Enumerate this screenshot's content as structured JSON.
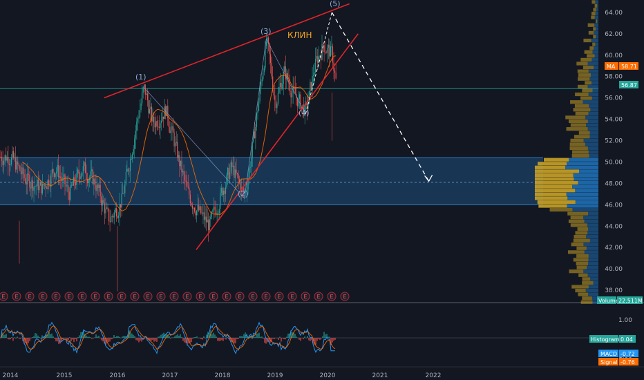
{
  "chart_data": {
    "type": "candlestick",
    "annotation": "КЛИН",
    "wave_labels": [
      "(1)",
      "(2)",
      "(3)",
      "(4)",
      "(5)"
    ],
    "wave_points": [
      {
        "label": "(1)",
        "date": "2016-07",
        "price": 57.0
      },
      {
        "label": "(2)",
        "date": "2018-06",
        "price": 46.6
      },
      {
        "label": "(3)",
        "date": "2018-11",
        "price": 61.5
      },
      {
        "label": "(4)",
        "date": "2019-08",
        "price": 54.5
      },
      {
        "label": "(5)",
        "date": "2020-02",
        "price": 64.0
      }
    ],
    "price_axis_ticks": [
      "64.00",
      "62.00",
      "60.00",
      "58.00",
      "56.00",
      "54.00",
      "52.00",
      "50.00",
      "48.00",
      "46.00",
      "44.00",
      "42.00",
      "40.00",
      "38.00"
    ],
    "time_axis_ticks": [
      "2014",
      "2015",
      "2016",
      "2017",
      "2018",
      "2019",
      "2020",
      "2021",
      "2022"
    ],
    "price_range": [
      36.7,
      65.5
    ],
    "value_area": {
      "high": 50.4,
      "low": 46.0,
      "poc": 48.1
    },
    "horizontal_line": 56.87,
    "upper_wedge_line": [
      {
        "date": "2015-10",
        "price": 56.0
      },
      {
        "date": "2020-06",
        "price": 64.8
      }
    ],
    "lower_wedge_line": [
      {
        "date": "2017-07",
        "price": 41.8
      },
      {
        "date": "2020-08",
        "price": 62.0
      }
    ],
    "projection": [
      {
        "date": "2020-02",
        "price": 64.0
      },
      {
        "date": "2021-12",
        "price": 48.2
      }
    ],
    "markers": {
      "ma": {
        "label": "MA",
        "value": "58.71"
      },
      "last_price": "56.87"
    },
    "volume": {
      "label": "Volume",
      "value": "22.511M"
    },
    "macd_pane": {
      "ticks": [
        "1.00",
        "0.00",
        "-1.00"
      ],
      "histogram": {
        "label": "Histogram",
        "value": "0.04"
      },
      "macd": {
        "label": "MACD",
        "value": "-0.72"
      },
      "signal": {
        "label": "Signal",
        "value": "-0.76"
      }
    },
    "earnings_marker": "E",
    "colors": {
      "background": "#131722",
      "up": "#26a69a",
      "down": "#ef5350",
      "wedge": "#e0252a",
      "annotation": "#f5a623",
      "ma": "#ff6d00",
      "macd": "#2196f3",
      "signal": "#ff6d00",
      "profile_blue": "#1f6fb5",
      "profile_gold": "#c9a227",
      "value_area_fill": "#1d4f7d"
    }
  }
}
